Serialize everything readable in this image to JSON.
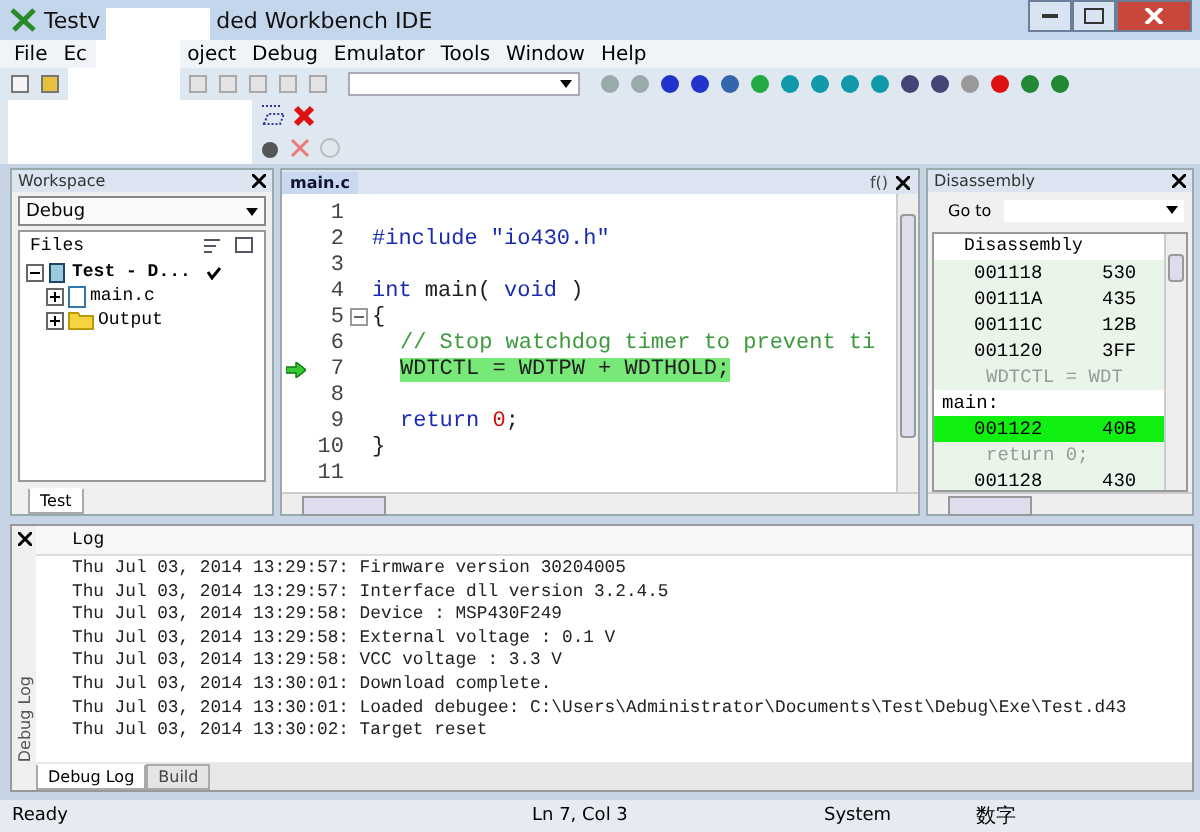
{
  "window": {
    "title_start": "Testv",
    "title_end": "ded Workbench IDE"
  },
  "menu": [
    "File",
    "Ec",
    "oject",
    "Debug",
    "Emulator",
    "Tools",
    "Window",
    "Help"
  ],
  "workspace": {
    "title": "Workspace",
    "configuration": "Debug",
    "files_header": "Files",
    "tree": [
      {
        "label": "Test - D...",
        "kind": "project",
        "checked": true,
        "expanded": true,
        "children": [
          {
            "label": "main.c",
            "kind": "file",
            "expanded": false
          },
          {
            "label": "Output",
            "kind": "folder",
            "expanded": false
          }
        ]
      }
    ],
    "tabs": [
      {
        "label": "Test",
        "selected": true
      }
    ]
  },
  "editor": {
    "tabs": [
      {
        "label": "main.c",
        "selected": true
      }
    ],
    "function_menu": "f()",
    "lines": [
      {
        "number": "1",
        "current": false
      },
      {
        "number": "2",
        "current": false,
        "tokens": [
          {
            "kind": "kw",
            "text": "#include"
          },
          {
            "kind": "str",
            "text": "\"io430.h\""
          }
        ]
      },
      {
        "number": "3",
        "current": false
      },
      {
        "number": "4",
        "current": false,
        "tokens": [
          {
            "kind": "kw",
            "text": "int"
          },
          {
            "kind": "plain",
            "text": "main("
          },
          {
            "kind": "kw",
            "text": "void"
          },
          {
            "kind": "plain",
            "text": ")"
          }
        ]
      },
      {
        "number": "5",
        "current": false,
        "tokens": [
          {
            "kind": "plain",
            "text": "{"
          }
        ]
      },
      {
        "number": "6",
        "current": false,
        "indented": true,
        "tokens": [
          {
            "kind": "comment",
            "text": "// Stop watchdog timer to prevent ti"
          }
        ]
      },
      {
        "number": "7",
        "current": true,
        "indented": true,
        "tokens": [
          {
            "kind": "plain",
            "text": "WDTCTL = WDTPW + WDTHOLD;"
          }
        ]
      },
      {
        "number": "8",
        "current": false
      },
      {
        "number": "9",
        "current": false,
        "indented": true,
        "tokens": [
          {
            "kind": "kw",
            "text": "return"
          },
          {
            "kind": "num",
            "text": "0"
          },
          {
            "kind": "plain",
            "text": ";"
          }
        ]
      },
      {
        "number": "10",
        "current": false,
        "tokens": [
          {
            "kind": "plain",
            "text": "}"
          }
        ]
      },
      {
        "number": "11",
        "current": false
      }
    ]
  },
  "disassembly": {
    "title": "Disassembly",
    "goto_label": "Go to",
    "header": "Disassembly",
    "rows": [
      {
        "kind": "instr",
        "address": "001118",
        "code": "530",
        "selected": false
      },
      {
        "kind": "instr",
        "address": "00111A",
        "code": "435",
        "selected": false
      },
      {
        "kind": "instr",
        "address": "00111C",
        "code": "12B",
        "selected": false
      },
      {
        "kind": "instr",
        "address": "001120",
        "code": "3FF",
        "selected": false
      },
      {
        "kind": "source",
        "text": "WDTCTL = WDT"
      },
      {
        "kind": "label",
        "text": "main:"
      },
      {
        "kind": "instr",
        "address": "001122",
        "code": "40B",
        "selected": true
      },
      {
        "kind": "source",
        "text": "return 0;"
      },
      {
        "kind": "instr",
        "address": "001128",
        "code": "430",
        "selected": false
      }
    ]
  },
  "log": {
    "side_title": "Debug Log",
    "header": "Log",
    "lines": [
      "Thu Jul 03, 2014 13:29:57: Firmware version 30204005",
      "Thu Jul 03, 2014 13:29:57: Interface dll version 3.2.4.5",
      "Thu Jul 03, 2014 13:29:58: Device : MSP430F249",
      "Thu Jul 03, 2014 13:29:58: External voltage : 0.1 V",
      "Thu Jul 03, 2014 13:29:58: VCC voltage : 3.3 V",
      "Thu Jul 03, 2014 13:30:01: Download complete.",
      "Thu Jul 03, 2014 13:30:01: Loaded debugee: C:\\Users\\Administrator\\Documents\\Test\\Debug\\Exe\\Test.d43",
      "Thu Jul 03, 2014 13:30:02: Target reset"
    ],
    "tabs": [
      {
        "label": "Debug Log",
        "selected": true
      },
      {
        "label": "Build",
        "selected": false
      }
    ]
  },
  "status_bar": {
    "message": "Ready",
    "position": "Ln 7, Col 3",
    "mode": "System",
    "input": "数字"
  }
}
